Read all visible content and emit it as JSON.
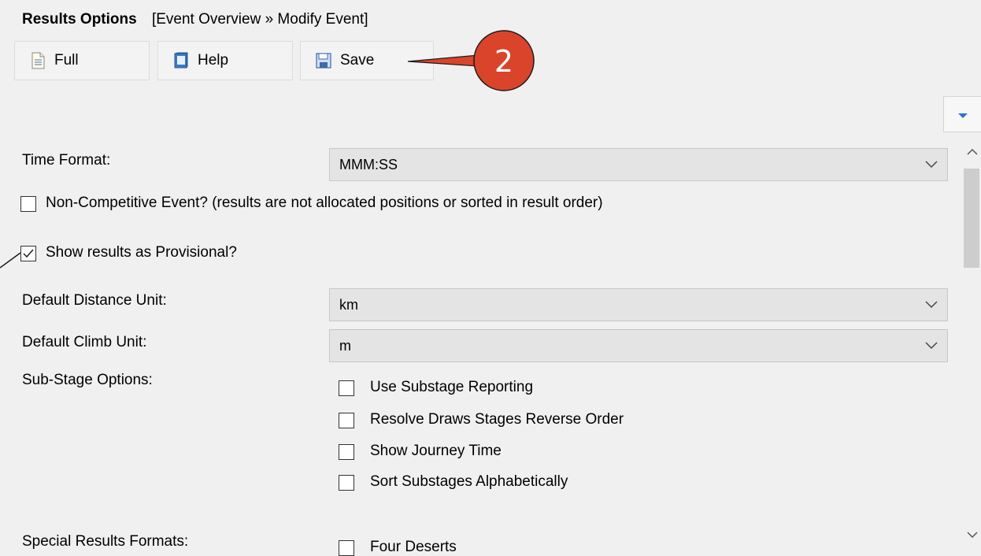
{
  "header": {
    "title": "Results Options",
    "breadcrumb": "[Event Overview » Modify Event]"
  },
  "toolbar": {
    "full_label": "Full",
    "help_label": "Help",
    "save_label": "Save"
  },
  "annotation": {
    "callout_number": "2",
    "callout_color": "#d9442b"
  },
  "form": {
    "time_format_label": "Time Format:",
    "time_format_value": "MMM:SS",
    "non_competitive_label": "Non-Competitive Event? (results are not allocated positions or sorted in result order)",
    "non_competitive_checked": false,
    "provisional_label": "Show results as Provisional?",
    "provisional_checked": true,
    "distance_unit_label": "Default Distance Unit:",
    "distance_unit_value": "km",
    "climb_unit_label": "Default Climb Unit:",
    "climb_unit_value": "m",
    "substage_label": "Sub-Stage Options:",
    "substage_options": [
      {
        "label": "Use Substage Reporting",
        "checked": false
      },
      {
        "label": "Resolve Draws Stages Reverse Order",
        "checked": false
      },
      {
        "label": "Show Journey Time",
        "checked": false
      },
      {
        "label": "Sort Substages Alphabetically",
        "checked": false
      }
    ],
    "special_formats_label": "Special Results Formats:",
    "special_formats_first": "Four Deserts"
  },
  "colors": {
    "accent_blue": "#2f6fd6",
    "window_bg": "#f0f0f0"
  }
}
